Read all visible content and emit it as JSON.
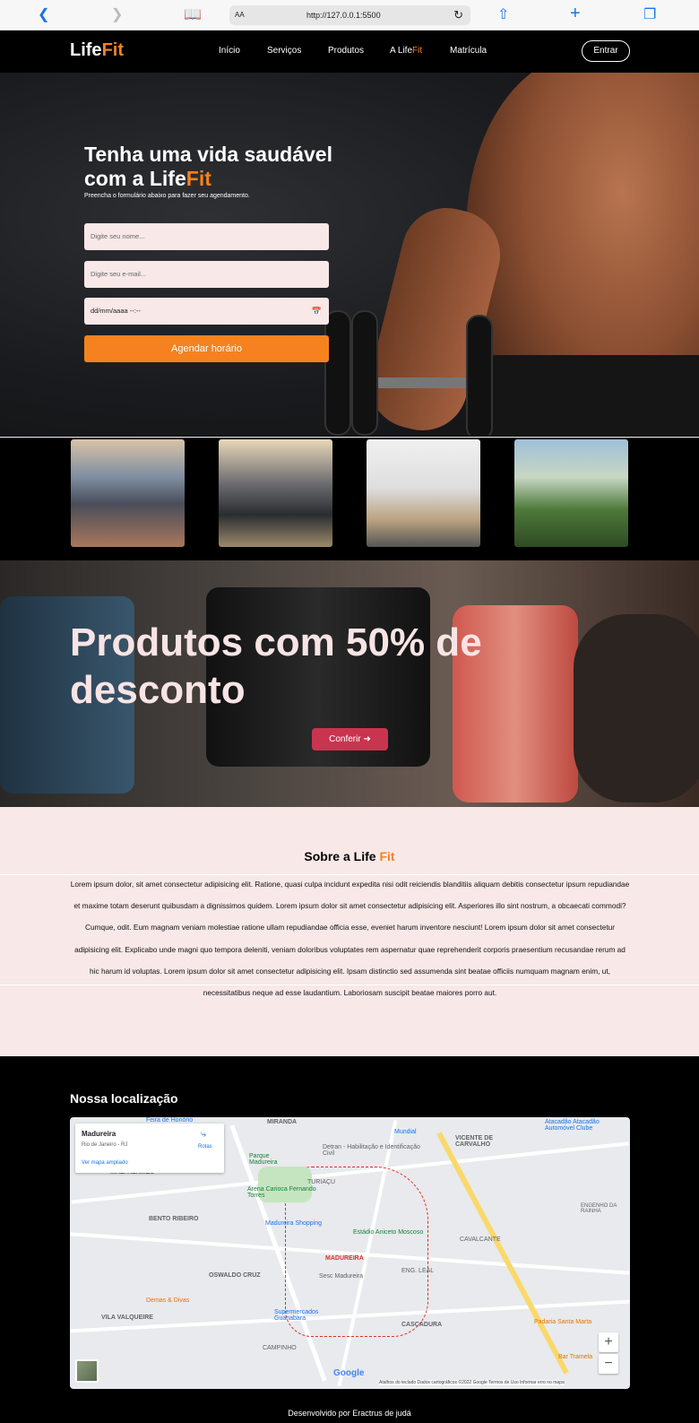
{
  "browser": {
    "text_size": "AA",
    "url": "http://127.0.0.1:5500"
  },
  "nav": {
    "logo_a": "Life",
    "logo_b": "Fit",
    "items": [
      "Início",
      "Serviços",
      "Produtos",
      "A Life",
      "Matrícula"
    ],
    "item4_suffix": "Fit",
    "login": "Entrar"
  },
  "hero": {
    "title_a": "Tenha uma vida saudável com a Life",
    "title_b": "Fit",
    "subtitle": "Preencha o formulário abaixo para fazer seu agendamento.",
    "name_placeholder": "Digite seu nome...",
    "email_placeholder": "Digite seu e-mail...",
    "date_placeholder": "dd/mm/aaaa --:--",
    "submit": "Agendar horário"
  },
  "promo": {
    "title": "Produtos com 50% de desconto",
    "button": "Conferir"
  },
  "about": {
    "title_a": "Sobre a Life ",
    "title_b": "Fit",
    "text": "Lorem ipsum dolor, sit amet consectetur adipisicing elit. Ratione, quasi culpa incidunt expedita nisi odit reiciendis blanditiis aliquam debitis consectetur ipsum repudiandae et maxime totam deserunt quibusdam a dignissimos quidem. Lorem ipsum dolor sit amet consectetur adipisicing elit. Asperiores illo sint nostrum, a obcaecati commodi? Cumque, odit. Eum magnam veniam molestiae ratione ullam repudiandae officia esse, eveniet harum inventore nesciunt! Lorem ipsum dolor sit amet consectetur adipisicing elit. Explicabo unde magni quo tempora deleniti, veniam doloribus voluptates rem aspernatur quae reprehenderit corporis praesentium recusandae rerum ad hic harum id voluptas. Lorem ipsum dolor sit amet consectetur adipisicing elit. Ipsam distinctio sed assumenda sint beatae officiis numquam magnam enim, ut, necessitatibus neque ad esse laudantium. Laboriosam suscipit beatae maiores porro aut."
  },
  "location": {
    "title": "Nossa localização",
    "card_title": "Madureira",
    "card_sub": "Rio de Janeiro - RJ",
    "card_link": "Ver mapa ampliado",
    "card_route": "Rotas",
    "labels": [
      "MIRANDA",
      "VICENTE DE CARVALHO",
      "MAL. HERMES",
      "BENTO RIBEIRO",
      "OSWALDO CRUZ",
      "VILA VALQUEIRE",
      "MADUREIRA",
      "CASCADURA",
      "CAVALCANTE",
      "ENG. LEAL",
      "TURIAÇU",
      "CAMPINHO",
      "ENGENHO DA RAINHA"
    ],
    "pois": [
      "Feira de Honório",
      "Mundial",
      "Atacadão Atacadão Automóvel Clube",
      "Detran - Habilitação e Identificação Civil",
      "Parque Madureira",
      "Arena Carioca Fernando Torres",
      "Madureira Shopping",
      "Estádio Aniceto Moscoso",
      "Supermercados Guanabara",
      "Sesc Madureira",
      "Demas & Divas",
      "Padaria Santa Marta",
      "Bar Tramela"
    ],
    "attribution": "Atalhos do teclado  Dados cartográficos ©2022 Google  Termos de Uso  Informar erro no mapa",
    "google": "Google"
  },
  "footer": {
    "text": "Desenvolvido por Eractrus de judá"
  },
  "colors": {
    "accent": "#f5821f",
    "promo_button": "#c9344f",
    "about_bg": "#f8e8e8"
  }
}
